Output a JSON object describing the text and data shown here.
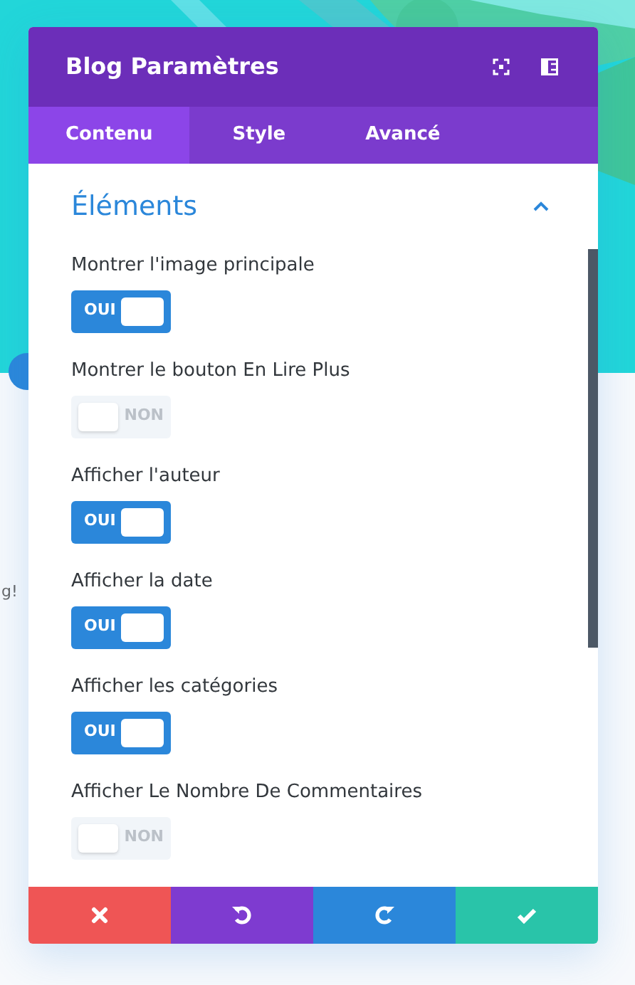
{
  "background": {
    "text_fragment": "g!"
  },
  "window": {
    "title": "Blog Paramètres"
  },
  "tabs": [
    {
      "label": "Contenu",
      "selected": true
    },
    {
      "label": "Style",
      "selected": false
    },
    {
      "label": "Avancé",
      "selected": false
    }
  ],
  "section": {
    "title": "Éléments",
    "expanded": true
  },
  "settings": [
    {
      "label": "Montrer l'image principale",
      "on": true,
      "text": "OUI"
    },
    {
      "label": "Montrer le bouton En Lire Plus",
      "on": false,
      "text": "NON"
    },
    {
      "label": "Afficher l'auteur",
      "on": true,
      "text": "OUI"
    },
    {
      "label": "Afficher la date",
      "on": true,
      "text": "OUI"
    },
    {
      "label": "Afficher les catégories",
      "on": true,
      "text": "OUI"
    },
    {
      "label": "Afficher Le Nombre De Commentaires",
      "on": false,
      "text": "NON"
    }
  ],
  "footer": [
    {
      "kind": "cancel"
    },
    {
      "kind": "undo"
    },
    {
      "kind": "redo"
    },
    {
      "kind": "save"
    }
  ]
}
